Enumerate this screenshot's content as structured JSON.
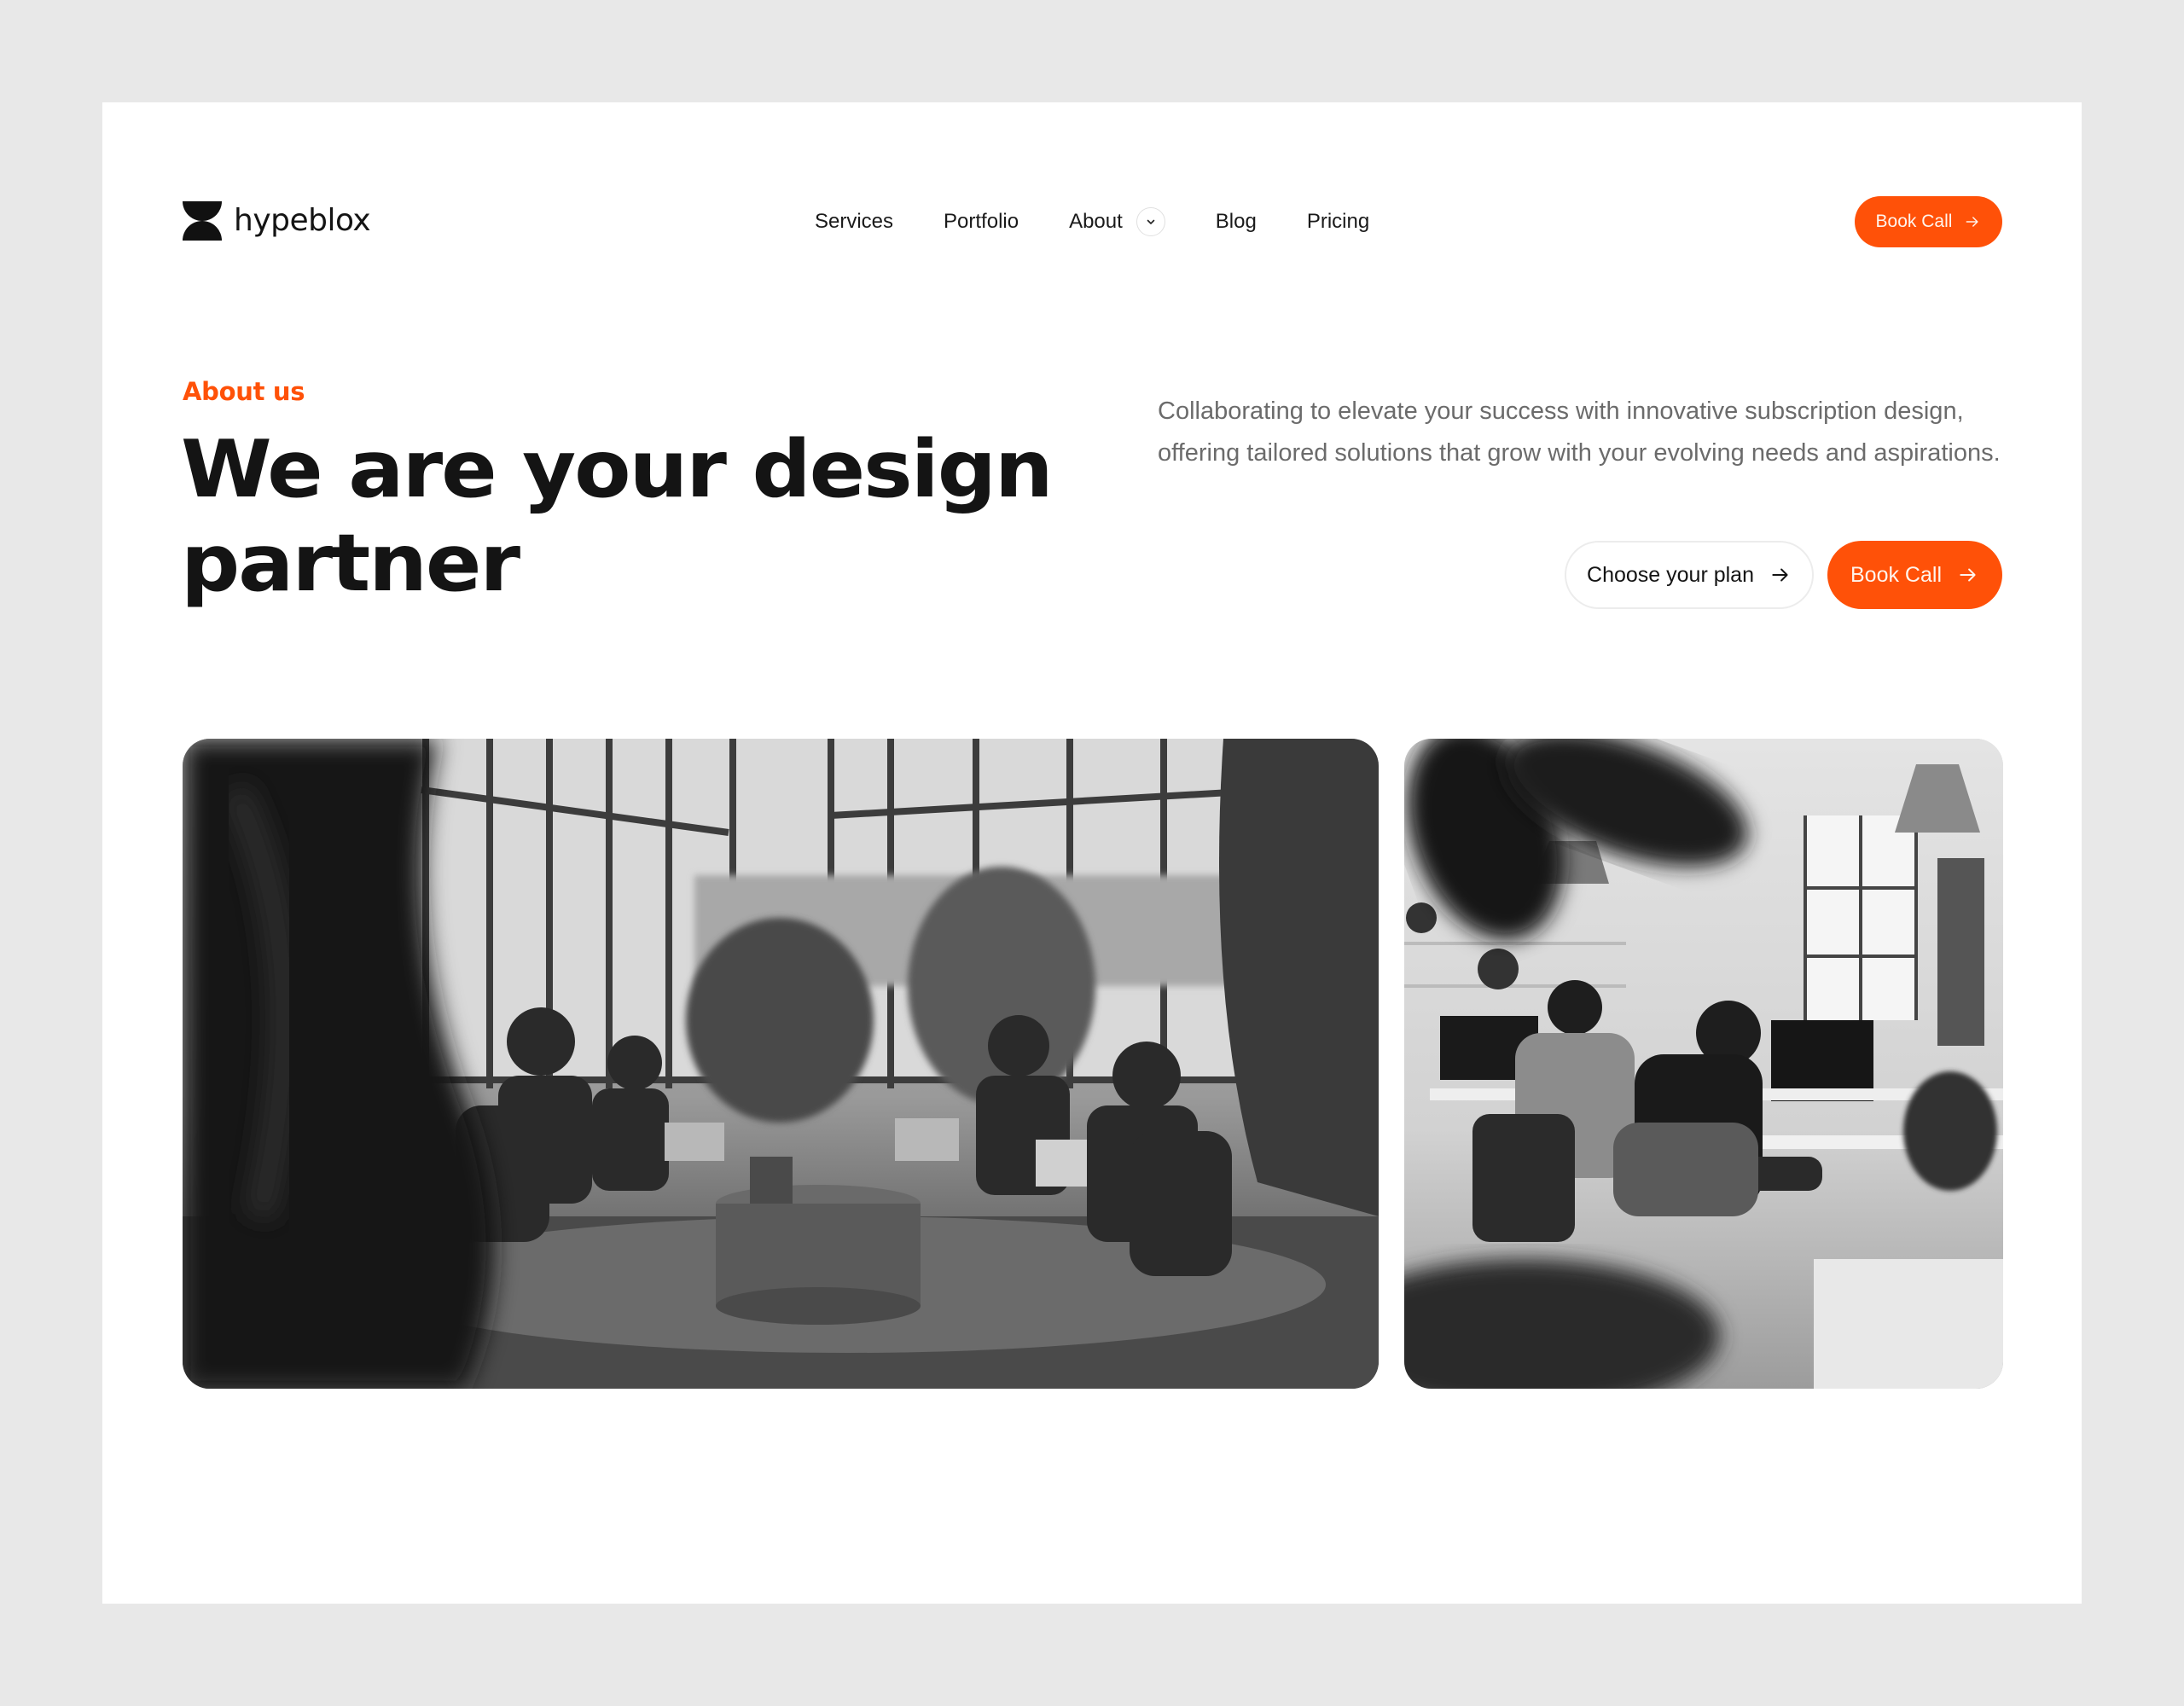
{
  "brand": {
    "name": "hypeblox",
    "logo_icon": "hourglass-logo-icon",
    "accent_color": "#ff5108"
  },
  "nav": {
    "items": [
      {
        "label": "Services"
      },
      {
        "label": "Portfolio"
      },
      {
        "label": "About",
        "has_dropdown": true,
        "icon": "chevron-down-icon"
      },
      {
        "label": "Blog"
      },
      {
        "label": "Pricing"
      }
    ]
  },
  "header": {
    "cta_label": "Book Call",
    "cta_icon": "arrow-right-icon"
  },
  "hero": {
    "eyebrow": "About us",
    "headline_line1": "We are your design",
    "headline_line2": "partner",
    "description": "Collaborating to elevate your success with innovative subscription design, offering tailored solutions that grow with your evolving needs and aspirations.",
    "secondary_cta_label": "Choose your plan",
    "primary_cta_label": "Book Call",
    "cta_icon": "arrow-right-icon"
  },
  "photos": [
    {
      "alt": "Team of four meeting in lounge chairs around a wooden table with laptops, black and white"
    },
    {
      "alt": "Two designers working at desktop computers in a bright plant-filled office, black and white"
    }
  ]
}
